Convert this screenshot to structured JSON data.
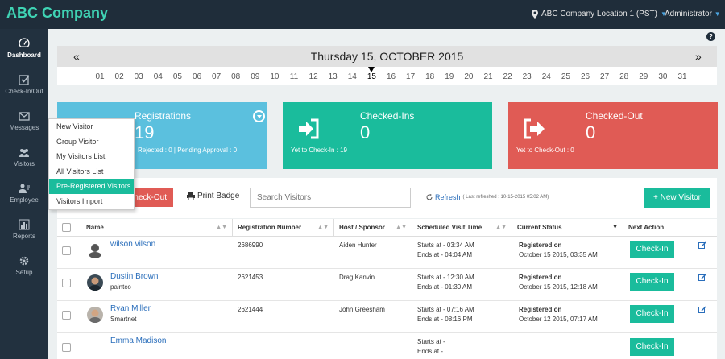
{
  "app": {
    "brand": "ABC Company"
  },
  "topbar": {
    "location": "ABC Company Location 1 (PST)",
    "user": "Administrator"
  },
  "sidebar": {
    "items": [
      {
        "label": "Dashboard",
        "icon": "dashboard-icon"
      },
      {
        "label": "Check-In/Out",
        "icon": "checkbox-icon"
      },
      {
        "label": "Messages",
        "icon": "envelope-icon"
      },
      {
        "label": "Visitors",
        "icon": "users-icon"
      },
      {
        "label": "Employee",
        "icon": "employee-icon"
      },
      {
        "label": "Reports",
        "icon": "bar-chart-icon"
      },
      {
        "label": "Setup",
        "icon": "gear-icon"
      }
    ]
  },
  "visitors_menu": {
    "items": [
      "New Visitor",
      "Group Visitor",
      "My Visitors List",
      "All Visitors List",
      "Pre-Registered Visitors",
      "Visitors Import"
    ],
    "selected_index": 4
  },
  "calendar": {
    "prev": "«",
    "next": "»",
    "title": "Thursday 15, OCTOBER 2015",
    "days": [
      "01",
      "02",
      "03",
      "04",
      "05",
      "06",
      "07",
      "08",
      "09",
      "10",
      "11",
      "12",
      "13",
      "14",
      "15",
      "16",
      "17",
      "18",
      "19",
      "20",
      "21",
      "22",
      "23",
      "24",
      "25",
      "26",
      "27",
      "28",
      "29",
      "30",
      "31"
    ],
    "current_day": "15"
  },
  "stats": {
    "registrations": {
      "title": "Registrations",
      "count": "19",
      "sub": "Rejected : 0 | Pending Approval : 0"
    },
    "checkins": {
      "title": "Checked-Ins",
      "count": "0",
      "sub": "Yet to Check-In : 19"
    },
    "checkouts": {
      "title": "Checked-Out",
      "count": "0",
      "sub": "Yet to Check-Out : 0"
    }
  },
  "toolbar": {
    "checkout_label": "heck-Out",
    "print_badge_label": "Print Badge",
    "search_placeholder": "Search Visitors",
    "refresh_label": "Refresh",
    "last_refreshed": "( Last refreshed : 10-15-2015 05:02 AM)",
    "new_visitor_label": "+ New Visitor"
  },
  "table": {
    "headers": [
      "Name",
      "Registration Number",
      "Host / Sponsor",
      "Scheduled Visit Time",
      "Current Status",
      "Next Action"
    ],
    "rows": [
      {
        "name": "wilson vilson",
        "company": "",
        "reg": "2686990",
        "host": "Aiden Hunter",
        "start": "Starts at - 03:34 AM",
        "end": "Ends at - 04:04 AM",
        "status": "Registered on",
        "status_date": "October 15 2015, 03:35 AM",
        "action": "Check-In"
      },
      {
        "name": "Dustin Brown",
        "company": "paintco",
        "reg": "2621453",
        "host": "Drag Kanvin",
        "start": "Starts at - 12:30 AM",
        "end": "Ends at - 01:30 AM",
        "status": "Registered on",
        "status_date": "October 15 2015, 12:18 AM",
        "action": "Check-In"
      },
      {
        "name": "Ryan Miller",
        "company": "Smartnet",
        "reg": "2621444",
        "host": "John Greesham",
        "start": "Starts at - 07:16 AM",
        "end": "Ends at - 08:16 PM",
        "status": "Registered on",
        "status_date": "October 12 2015, 07:17 AM",
        "action": "Check-In"
      },
      {
        "name": "Emma Madison",
        "company": "",
        "reg": "",
        "host": "",
        "start": "Starts at -",
        "end": "Ends at -",
        "status": "",
        "status_date": "",
        "action": "Check-In"
      }
    ]
  },
  "colors": {
    "teal": "#1abc9c",
    "blue": "#5bc0de",
    "red": "#e05b55",
    "navy": "#1f2d3a"
  }
}
